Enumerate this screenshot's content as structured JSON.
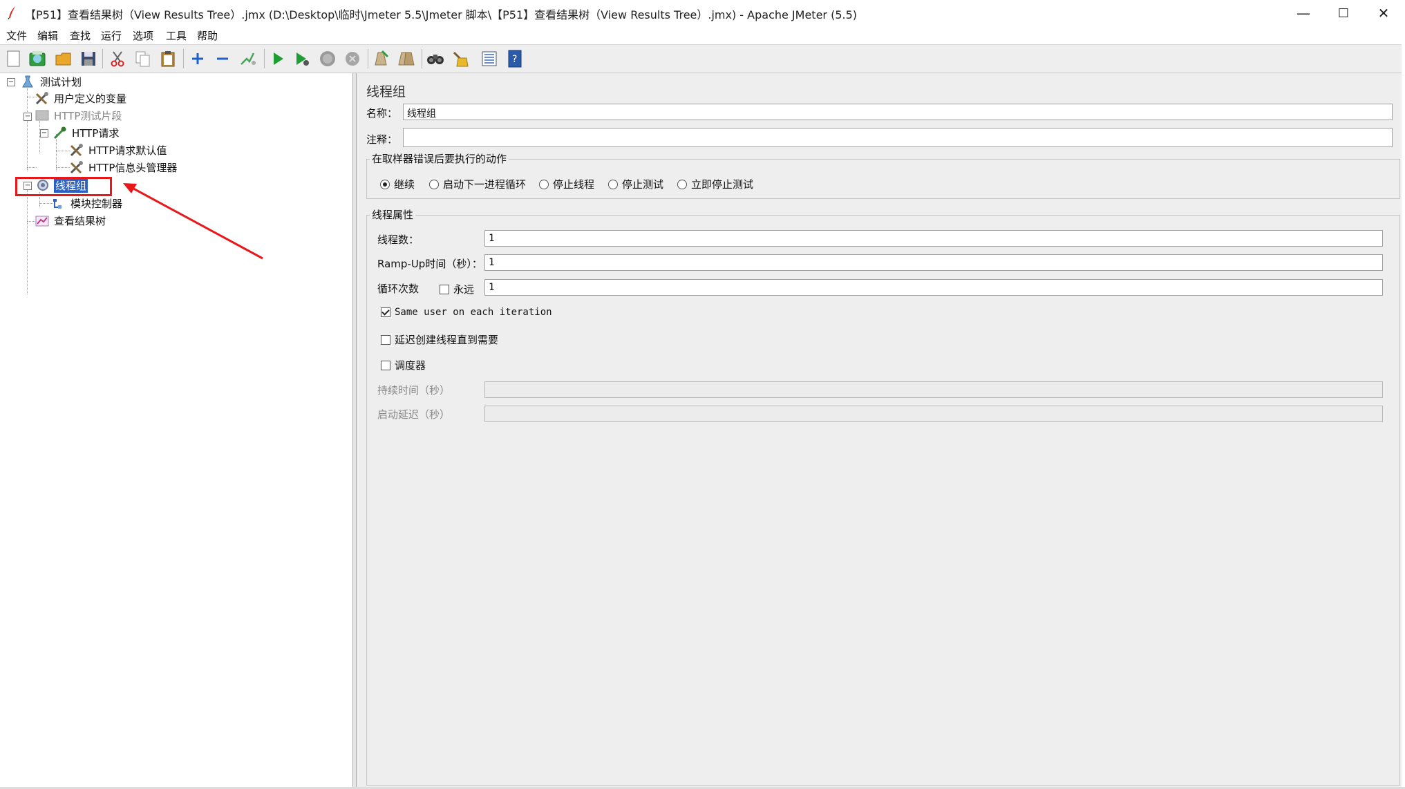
{
  "window": {
    "title": "【P51】查看结果树（View Results Tree）.jmx (D:\\Desktop\\临时\\Jmeter 5.5\\Jmeter 脚本\\【P51】查看结果树（View Results Tree）.jmx) - Apache JMeter (5.5)",
    "minimize": "—",
    "maximize": "☐",
    "close": "✕"
  },
  "menu": {
    "file": "文件",
    "edit": "编辑",
    "search": "查找",
    "run": "运行",
    "options": "选项",
    "tools": "工具",
    "help": "帮助"
  },
  "toolbar": {
    "icons": [
      "new-icon",
      "templates-icon",
      "open-icon",
      "save-icon",
      "cut-icon",
      "copy-icon",
      "paste-icon",
      "expand-icon",
      "collapse-icon",
      "toggle-icon",
      "start-icon",
      "start-no-pause-icon",
      "stop-icon",
      "shutdown-icon",
      "clear-icon",
      "clear-all-icon",
      "search-icon",
      "reset-search-icon",
      "function-helper-icon",
      "help-icon"
    ]
  },
  "tree": {
    "test_plan": "测试计划",
    "user_vars": "用户定义的变量",
    "http_fragment": "HTTP测试片段",
    "http_request": "HTTP请求",
    "http_defaults": "HTTP请求默认值",
    "http_header": "HTTP信息头管理器",
    "thread_group": "线程组",
    "module_controller": "模块控制器",
    "view_results_tree": "查看结果树"
  },
  "panel": {
    "title": "线程组",
    "name_label": "名称：",
    "name_value": "线程组",
    "comment_label": "注释：",
    "comment_value": "",
    "error_group_title": "在取样器错误后要执行的动作",
    "error_actions": [
      "继续",
      "启动下一进程循环",
      "停止线程",
      "停止测试",
      "立即停止测试"
    ],
    "selected_action": "继续",
    "thread_props_title": "线程属性",
    "threads_label": "线程数：",
    "threads_value": "1",
    "rampup_label": "Ramp-Up时间（秒）：",
    "rampup_value": "1",
    "loop_label": "循环次数",
    "forever_label": "永远",
    "loop_value": "1",
    "same_user_label": "Same user on each iteration",
    "delay_label": "延迟创建线程直到需要",
    "scheduler_label": "调度器",
    "duration_label": "持续时间（秒）",
    "duration_value": "",
    "startup_delay_label": "启动延迟（秒）",
    "startup_delay_value": ""
  },
  "colors": {
    "selection": "#2a62c8",
    "annotation": "#e8171a",
    "panel_bg": "#eeeeee"
  }
}
